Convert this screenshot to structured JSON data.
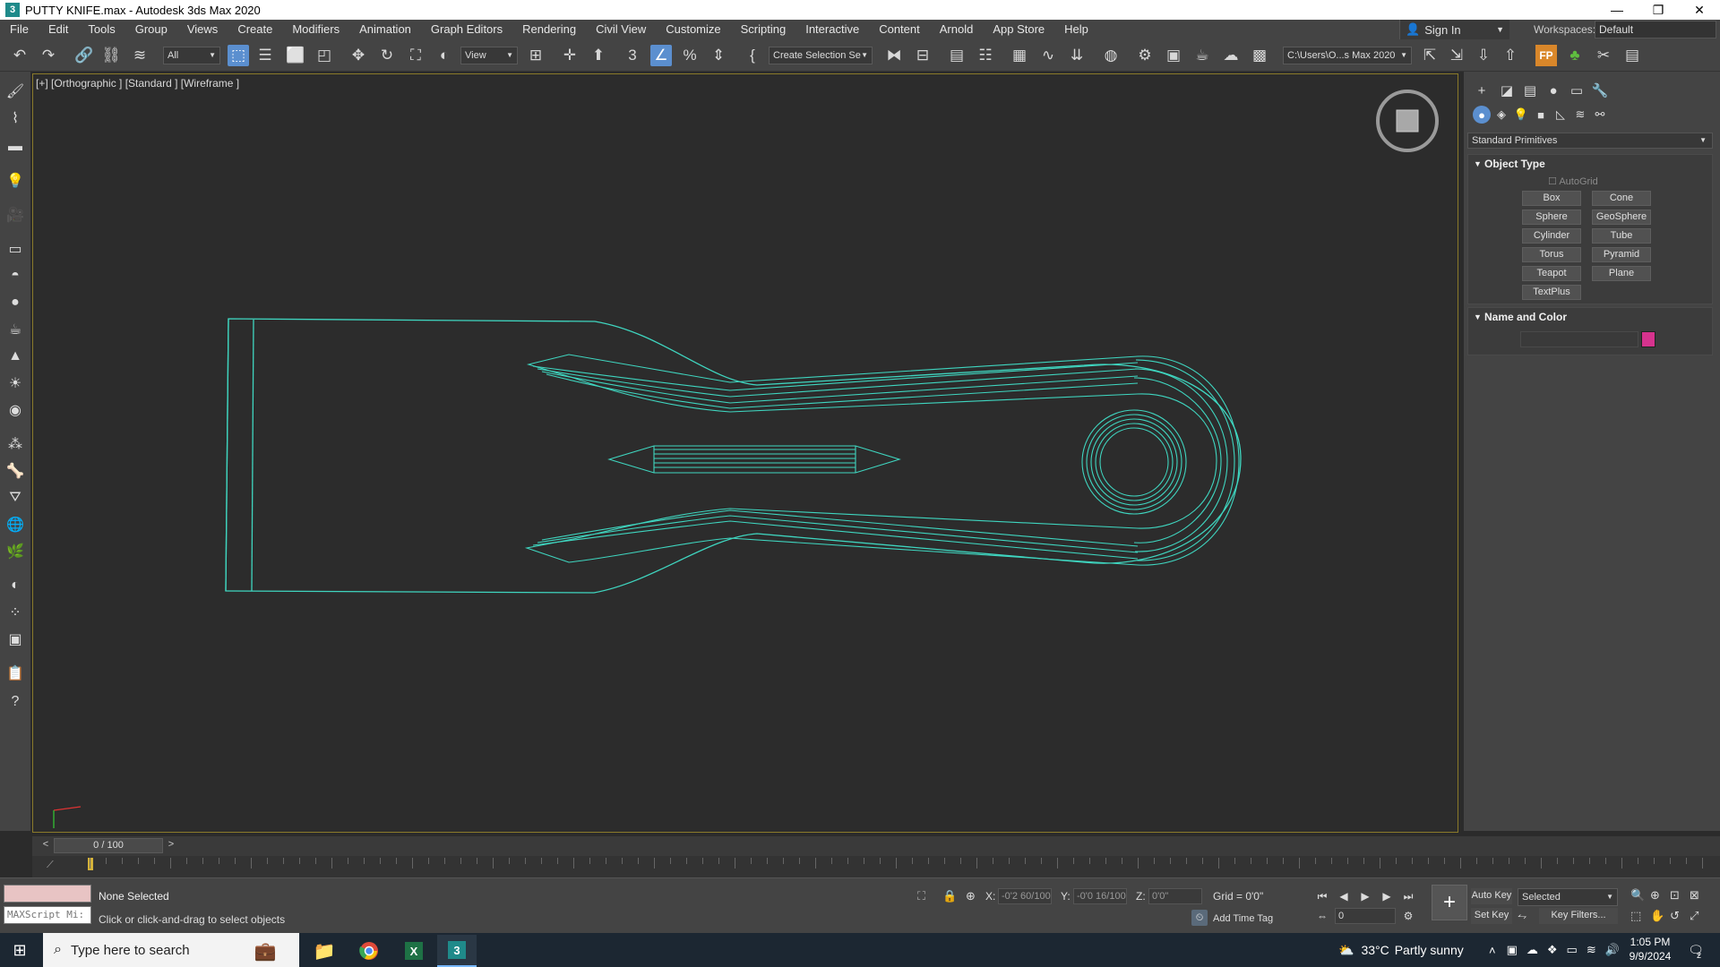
{
  "window": {
    "title": "PUTTY KNIFE.max - Autodesk 3ds Max 2020",
    "controls": [
      "—",
      "❐",
      "✕"
    ]
  },
  "menubar": {
    "items": [
      "File",
      "Edit",
      "Tools",
      "Group",
      "Views",
      "Create",
      "Modifiers",
      "Animation",
      "Graph Editors",
      "Rendering",
      "Civil View",
      "Customize",
      "Scripting",
      "Interactive",
      "Content",
      "Arnold",
      "App Store",
      "Help"
    ],
    "sign_in": "Sign In",
    "workspaces_label": "Workspaces:",
    "workspaces_value": "Default"
  },
  "toolbar": {
    "selection_filter": "All",
    "reference_coord": "View",
    "named_selection": "Create Selection Se",
    "project_path": "C:\\Users\\O...s Max 2020"
  },
  "viewport": {
    "label": "[+] [Orthographic ] [Standard ] [Wireframe ]",
    "wire_color": "#3fd6c0",
    "viewcube_face": "TOP"
  },
  "command_panel": {
    "category_dropdown": "Standard Primitives",
    "object_type": {
      "header": "Object Type",
      "autogrid": "AutoGrid",
      "buttons": [
        "Box",
        "Cone",
        "Sphere",
        "GeoSphere",
        "Cylinder",
        "Tube",
        "Torus",
        "Pyramid",
        "Teapot",
        "Plane",
        "TextPlus"
      ]
    },
    "name_and_color": {
      "header": "Name and Color",
      "name_value": "",
      "color": "#d6338e"
    }
  },
  "timeline": {
    "frame_display": "0 / 100",
    "prev": "<",
    "next": ">"
  },
  "status": {
    "selection": "None Selected",
    "prompt": "Click or click-and-drag to select objects",
    "maxscript_placeholder": "MAXScript Mi:",
    "x_label": "X:",
    "x_value": "-0'2 60/100",
    "y_label": "Y:",
    "y_value": "-0'0 16/100",
    "z_label": "Z:",
    "z_value": "0'0\"",
    "grid": "Grid = 0'0\"",
    "add_time_tag": "Add Time Tag",
    "auto_key": "Auto Key",
    "set_key": "Set Key",
    "key_mode": "Selected",
    "key_filters": "Key Filters...",
    "current_frame": "0"
  },
  "taskbar": {
    "search_placeholder": "Type here to search",
    "weather_temp": "33°C",
    "weather_desc": "Partly sunny",
    "time": "1:05 PM",
    "date": "9/9/2024",
    "notification_count": "2"
  }
}
